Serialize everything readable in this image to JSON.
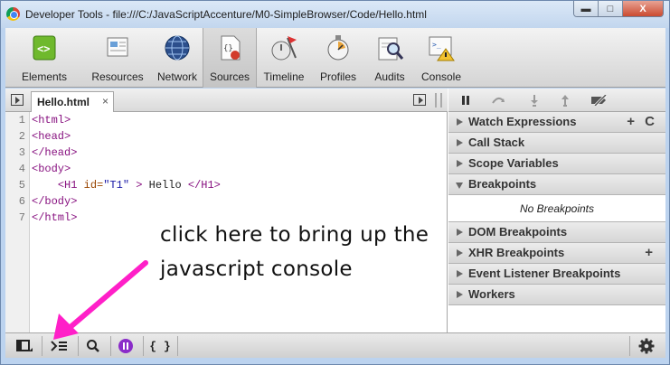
{
  "window": {
    "title": "Developer Tools - file:///C:/JavaScriptAccenture/M0-SimpleBrowser/Code/Hello.html",
    "minimize": "▬",
    "maximize": "□",
    "close": "X"
  },
  "toolbar": {
    "items": [
      {
        "label": "Elements",
        "icon": "elements-icon"
      },
      {
        "label": "Resources",
        "icon": "resources-icon"
      },
      {
        "label": "Network",
        "icon": "network-icon"
      },
      {
        "label": "Sources",
        "icon": "sources-icon",
        "active": true
      },
      {
        "label": "Timeline",
        "icon": "timeline-icon"
      },
      {
        "label": "Profiles",
        "icon": "profiles-icon"
      },
      {
        "label": "Audits",
        "icon": "audits-icon"
      },
      {
        "label": "Console",
        "icon": "console-icon"
      }
    ]
  },
  "editor": {
    "tab_label": "Hello.html",
    "tab_close": "×",
    "line_numbers": [
      "1",
      "2",
      "3",
      "4",
      "5",
      "6",
      "7"
    ],
    "lines": [
      {
        "a": "<html>"
      },
      {
        "a": "<head>"
      },
      {
        "a": "</head>"
      },
      {
        "a": "<body>"
      },
      {
        "indent": "    ",
        "tag_open": "<H1",
        "attr": " id=",
        "val": "\"T1\"",
        "tag_close": " >",
        "text": " Hello ",
        "end_tag": "</H1>"
      },
      {
        "a": "</body>"
      },
      {
        "a": "</html>"
      }
    ]
  },
  "sidebar": {
    "sections": [
      {
        "label": "Watch Expressions",
        "open": false
      },
      {
        "label": "Call Stack",
        "open": false
      },
      {
        "label": "Scope Variables",
        "open": false
      },
      {
        "label": "Breakpoints",
        "open": true,
        "body": "No Breakpoints"
      },
      {
        "label": "DOM Breakpoints",
        "open": false
      },
      {
        "label": "XHR Breakpoints",
        "open": false
      },
      {
        "label": "Event Listener Breakpoints",
        "open": false
      },
      {
        "label": "Workers",
        "open": false
      }
    ],
    "add_symbol": "+",
    "refresh_symbol": "C"
  },
  "statusbar": {
    "pretty_print": "{ }"
  },
  "annotation": {
    "line1": "click here to bring up the",
    "line2": "javascript console",
    "arrow_color": "#ff1fc8"
  }
}
